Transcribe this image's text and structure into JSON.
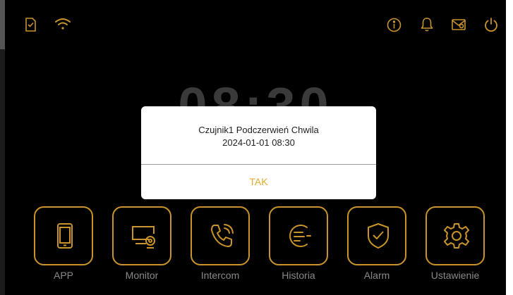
{
  "status_bar": {
    "left_icons": [
      "sd-card-icon",
      "wifi-icon"
    ],
    "right_icons": [
      "info-icon",
      "bell-icon",
      "message-icon",
      "power-icon"
    ]
  },
  "clock": {
    "time": "08:30"
  },
  "dialog": {
    "line1": "Czujnik1 Podczerwień Chwila",
    "line2": "2024-01-01 08:30",
    "ok_label": "TAK"
  },
  "tiles": [
    {
      "label": "APP",
      "icon": "phone-icon"
    },
    {
      "label": "Monitor",
      "icon": "monitor-camera-icon"
    },
    {
      "label": "Intercom",
      "icon": "handset-icon"
    },
    {
      "label": "Historia",
      "icon": "history-icon"
    },
    {
      "label": "Alarm",
      "icon": "shield-check-icon"
    },
    {
      "label": "Ustawienie",
      "icon": "gear-icon"
    }
  ],
  "colors": {
    "accent": "#c9942c",
    "dialog_button": "#e0ac2c",
    "background": "#000000",
    "label": "#8a8a8a"
  }
}
